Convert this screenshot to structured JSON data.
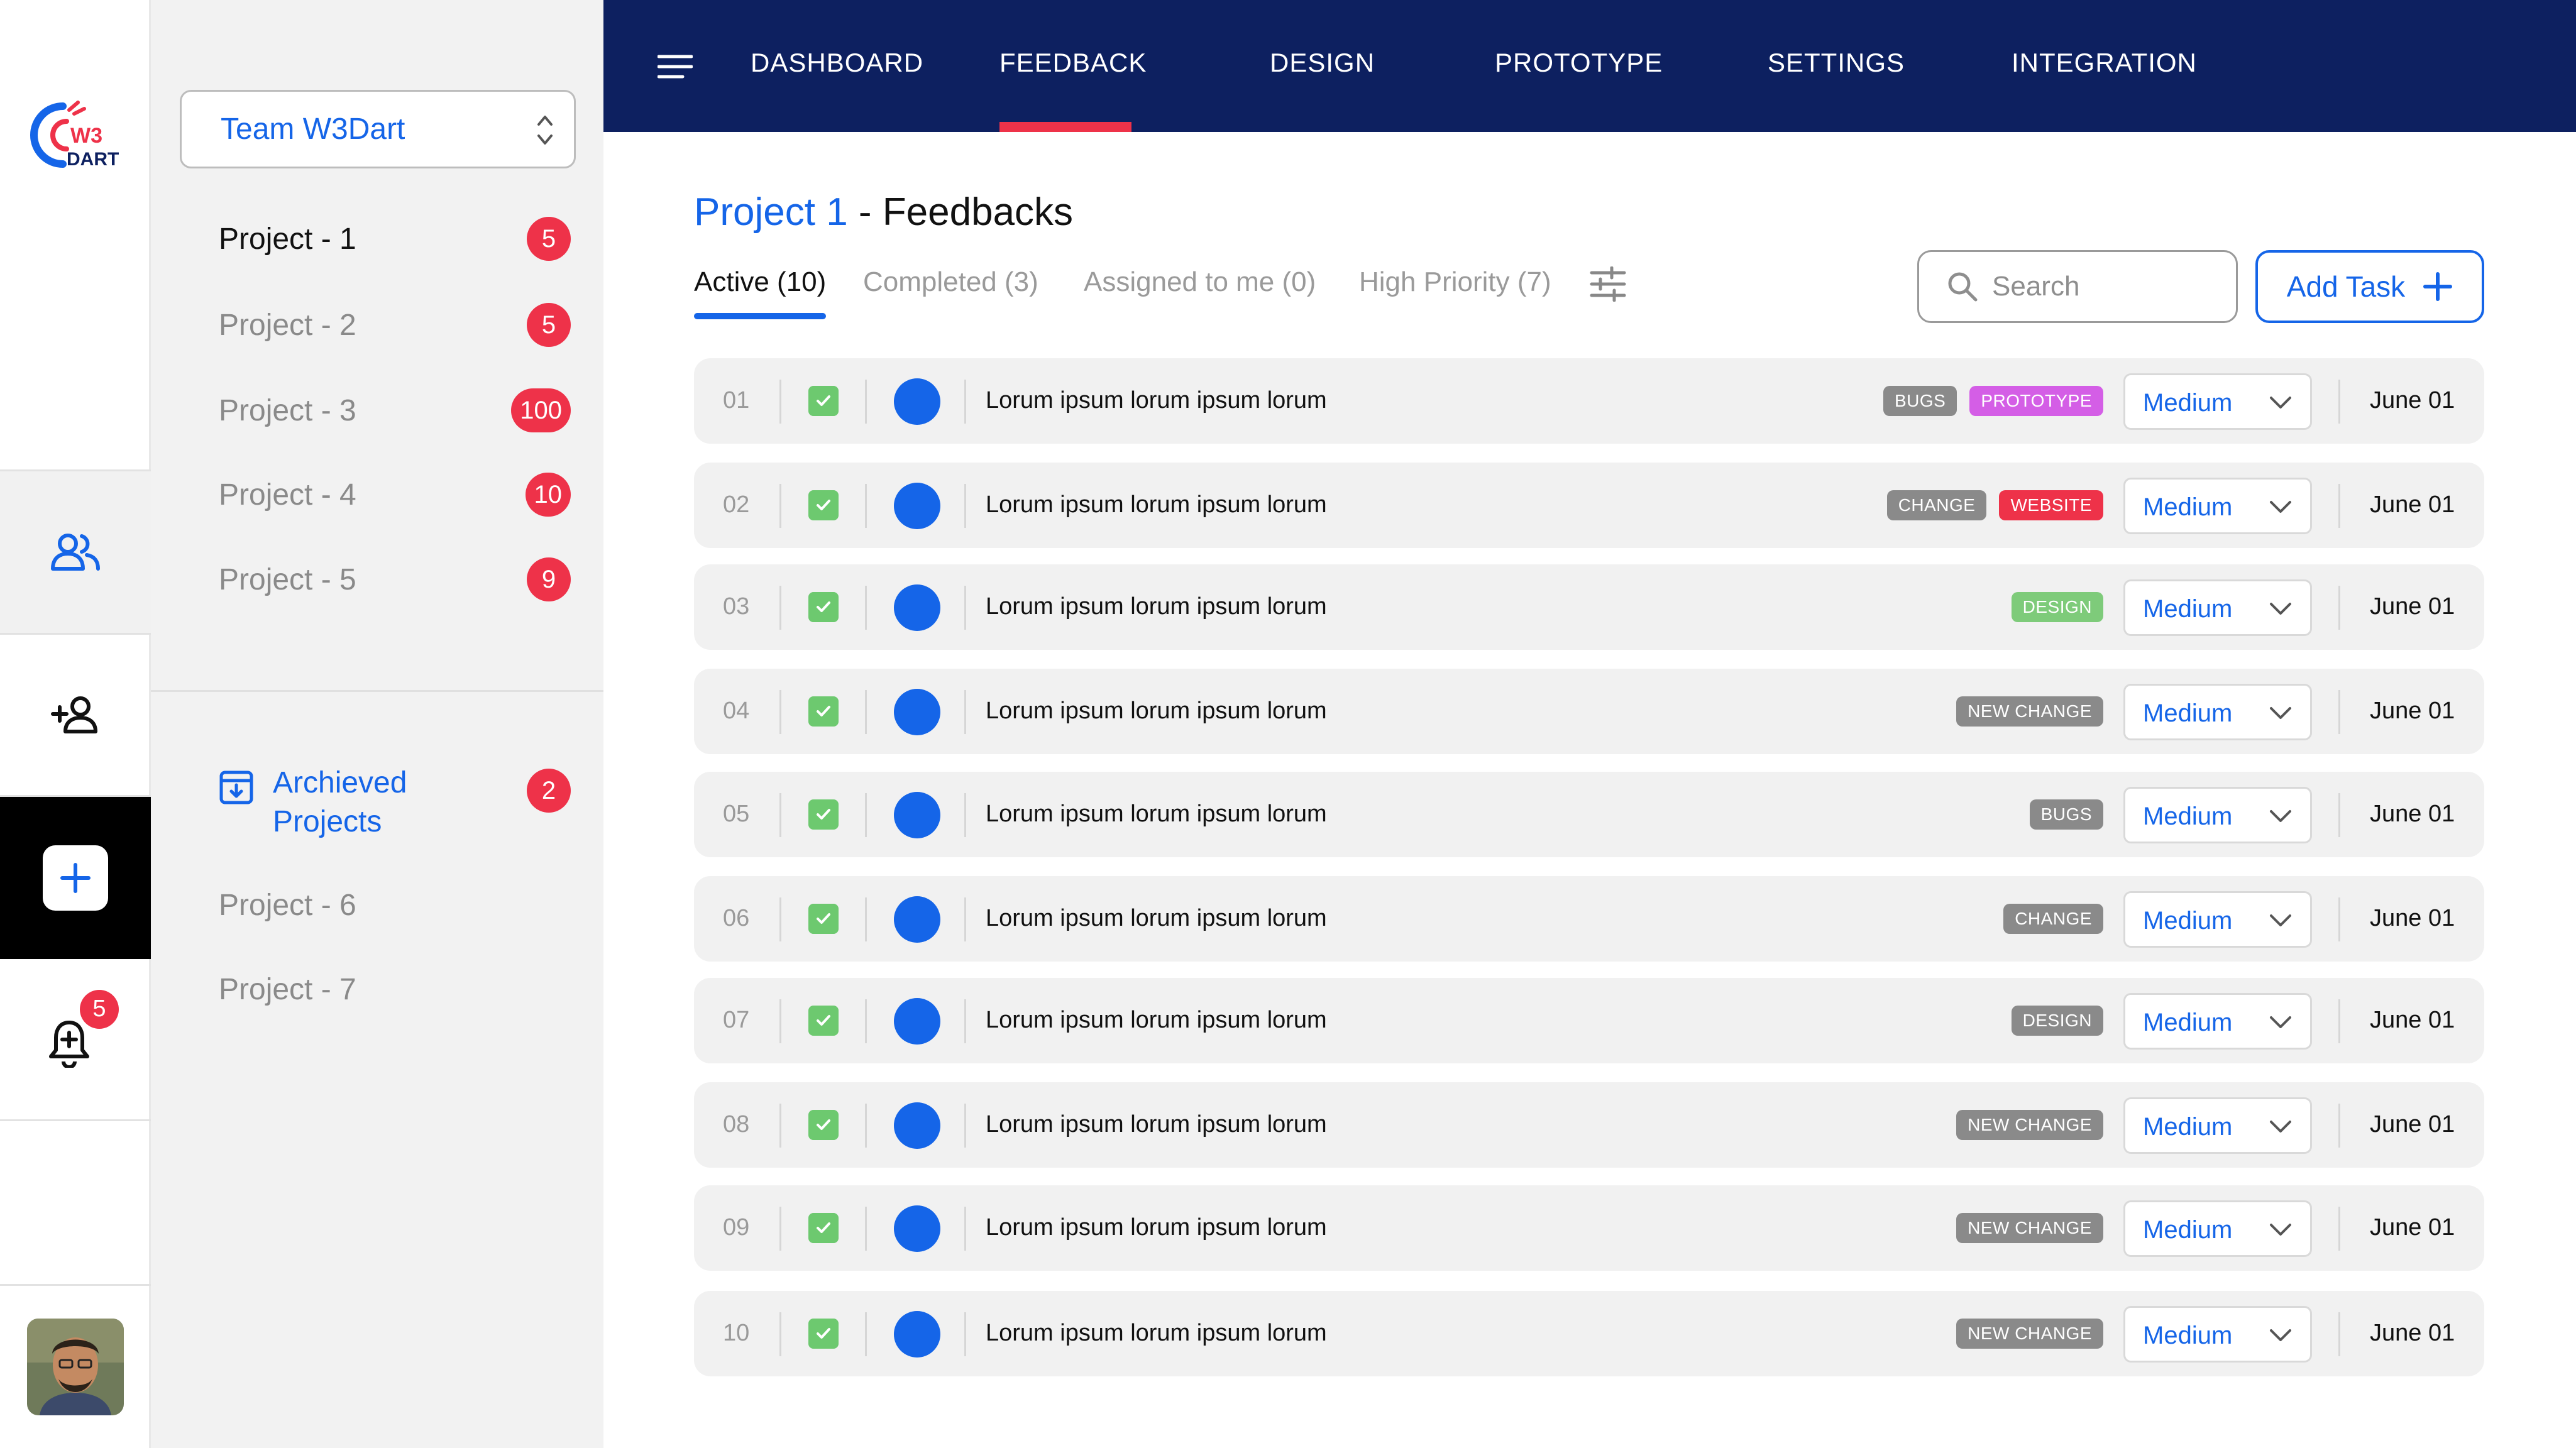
{
  "brand": {
    "logo_top": "W3",
    "logo_bottom": "DART"
  },
  "rail": {
    "notification_count": "5"
  },
  "team": {
    "name": "Team W3Dart"
  },
  "projects": [
    {
      "label": "Project - 1",
      "count": "5",
      "active": true
    },
    {
      "label": "Project - 2",
      "count": "5"
    },
    {
      "label": "Project - 3",
      "count": "100"
    },
    {
      "label": "Project - 4",
      "count": "10"
    },
    {
      "label": "Project - 5",
      "count": "9"
    }
  ],
  "archived": {
    "label": "Archieved Projects",
    "count": "2",
    "projects": [
      "Project - 6",
      "Project - 7"
    ]
  },
  "nav": {
    "tabs": [
      "DASHBOARD",
      "FEEDBACK",
      "DESIGN",
      "PROTOTYPE",
      "SETTINGS",
      "INTEGRATION"
    ],
    "active": "FEEDBACK"
  },
  "page": {
    "project": "Project 1",
    "title_suffix": " - Feedbacks"
  },
  "filters": [
    "Active (10)",
    "Completed (3)",
    "Assigned to me (0)",
    "High Priority (7)"
  ],
  "search": {
    "placeholder": "Search"
  },
  "add_task_label": "Add Task",
  "colors": {
    "accent": "#1565e8",
    "nav_bg": "#0d2060",
    "badge": "#ee3249",
    "check": "#6dc96f",
    "tag_gray": "#8a8a8a",
    "tag_prototype": "#d45ee6",
    "tag_website": "#ee3249",
    "tag_design": "#7ecb7a"
  },
  "tasks": [
    {
      "num": "01",
      "text": "Lorum ipsum lorum ipsum lorum",
      "tags": [
        {
          "label": "BUGS",
          "color": "#8a8a8a"
        },
        {
          "label": "PROTOTYPE",
          "color": "#d45ee6"
        }
      ],
      "priority": "Medium",
      "date": "June 01"
    },
    {
      "num": "02",
      "text": "Lorum ipsum lorum ipsum lorum",
      "tags": [
        {
          "label": "CHANGE",
          "color": "#8a8a8a"
        },
        {
          "label": "WEBSITE",
          "color": "#ee3249"
        }
      ],
      "priority": "Medium",
      "date": "June 01"
    },
    {
      "num": "03",
      "text": "Lorum ipsum lorum ipsum lorum",
      "tags": [
        {
          "label": "DESIGN",
          "color": "#7ecb7a"
        }
      ],
      "priority": "Medium",
      "date": "June 01"
    },
    {
      "num": "04",
      "text": "Lorum ipsum lorum ipsum lorum",
      "tags": [
        {
          "label": "NEW CHANGE",
          "color": "#8a8a8a"
        }
      ],
      "priority": "Medium",
      "date": "June 01"
    },
    {
      "num": "05",
      "text": "Lorum ipsum lorum ipsum lorum",
      "tags": [
        {
          "label": "BUGS",
          "color": "#8a8a8a"
        }
      ],
      "priority": "Medium",
      "date": "June 01"
    },
    {
      "num": "06",
      "text": "Lorum ipsum lorum ipsum lorum",
      "tags": [
        {
          "label": "CHANGE",
          "color": "#8a8a8a"
        }
      ],
      "priority": "Medium",
      "date": "June 01"
    },
    {
      "num": "07",
      "text": "Lorum ipsum lorum ipsum lorum",
      "tags": [
        {
          "label": "DESIGN",
          "color": "#8a8a8a"
        }
      ],
      "priority": "Medium",
      "date": "June 01"
    },
    {
      "num": "08",
      "text": "Lorum ipsum lorum ipsum lorum",
      "tags": [
        {
          "label": "NEW CHANGE",
          "color": "#8a8a8a"
        }
      ],
      "priority": "Medium",
      "date": "June 01"
    },
    {
      "num": "09",
      "text": "Lorum ipsum lorum ipsum lorum",
      "tags": [
        {
          "label": "NEW CHANGE",
          "color": "#8a8a8a"
        }
      ],
      "priority": "Medium",
      "date": "June 01"
    },
    {
      "num": "10",
      "text": "Lorum ipsum lorum ipsum lorum",
      "tags": [
        {
          "label": "NEW CHANGE",
          "color": "#8a8a8a"
        }
      ],
      "priority": "Medium",
      "date": "June 01"
    }
  ]
}
